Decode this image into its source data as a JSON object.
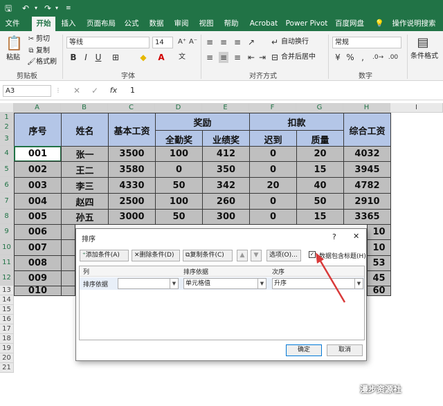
{
  "ribbon_tabs": [
    "文件",
    "开始",
    "插入",
    "页面布局",
    "公式",
    "数据",
    "审阅",
    "视图",
    "帮助",
    "Acrobat",
    "Power Pivot",
    "百度网盘",
    "操作说明搜索"
  ],
  "clipboard": {
    "cut": "剪切",
    "copy": "复制",
    "paste": "粘贴",
    "painter": "格式刷",
    "group": "剪贴板"
  },
  "font": {
    "name": "等线",
    "size": "14",
    "bold": "B",
    "italic": "I",
    "underline": "U",
    "group": "字体"
  },
  "alignment": {
    "wrap": "自动换行",
    "merge": "合并后居中",
    "group": "对齐方式"
  },
  "number": {
    "format": "常规",
    "percent": "%",
    "comma": ",",
    "group": "数字"
  },
  "styles": {
    "cond": "条件格式"
  },
  "formula_bar": {
    "cell_ref": "A3",
    "fx": "fx",
    "value": "1"
  },
  "columns": [
    "A",
    "B",
    "C",
    "D",
    "E",
    "F",
    "G",
    "H",
    "I"
  ],
  "rows": [
    "1",
    "2",
    "3",
    "4",
    "5",
    "6",
    "7",
    "8",
    "9",
    "10",
    "11",
    "12",
    "13",
    "14",
    "15",
    "16",
    "17",
    "18",
    "19",
    "20",
    "21"
  ],
  "table": {
    "headers": {
      "seq": "序号",
      "name": "姓名",
      "base": "基本工资",
      "bonus": "奖励",
      "attend": "全勤奖",
      "perf": "业绩奖",
      "deduct": "扣款",
      "late": "迟到",
      "quality": "质量",
      "total": "综合工资"
    },
    "data_rows": [
      [
        "001",
        "张一",
        "3500",
        "100",
        "412",
        "0",
        "20",
        "4032"
      ],
      [
        "002",
        "王二",
        "3580",
        "0",
        "350",
        "0",
        "15",
        "3945"
      ],
      [
        "003",
        "李三",
        "4330",
        "50",
        "342",
        "20",
        "40",
        "4782"
      ],
      [
        "004",
        "赵四",
        "2500",
        "100",
        "260",
        "0",
        "50",
        "2910"
      ],
      [
        "005",
        "孙五",
        "3000",
        "50",
        "300",
        "0",
        "15",
        "3365"
      ]
    ],
    "hidden_rows": [
      {
        "seq": "006",
        "total": "10"
      },
      {
        "seq": "007",
        "total": "10"
      },
      {
        "seq": "008",
        "total": "53"
      },
      {
        "seq": "009",
        "total": "45"
      },
      {
        "seq": "010",
        "total": "60"
      }
    ]
  },
  "dialog": {
    "title": "排序",
    "help": "?",
    "close": "✕",
    "add": "添加条件(A)",
    "delete": "删除条件(D)",
    "copy": "复制条件(C)",
    "options": "选项(O)...",
    "has_headers": "数据包含标题(H)",
    "col_header": "列",
    "basis_header": "排序依据",
    "order_header": "次序",
    "row_label": "排序依据",
    "basis_value": "单元格值",
    "order_value": "升序",
    "ok": "确定",
    "cancel": "取消"
  },
  "watermark": "漫步资源社",
  "colors": {
    "green": "#217346",
    "header_fill": "#b4c6e7",
    "body_fill": "#bfbfbf",
    "arrow": "#d93a3a"
  }
}
